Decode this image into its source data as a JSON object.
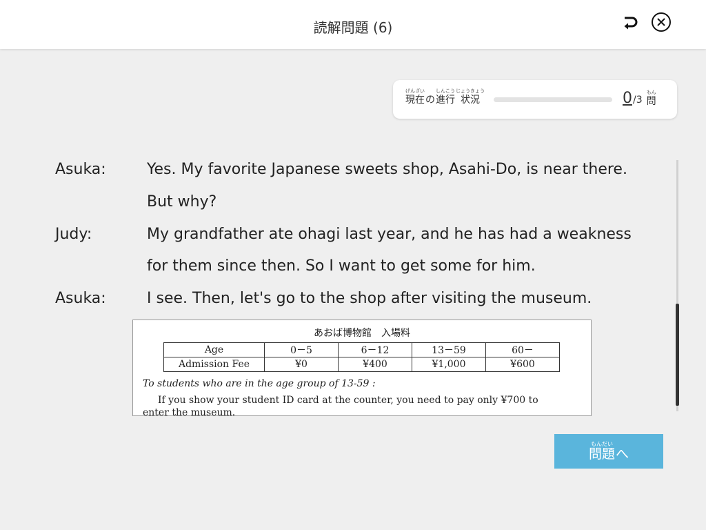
{
  "header": {
    "title": "読解問題 (6)"
  },
  "progress": {
    "label_parts": [
      {
        "base": "現在",
        "ruby": "げんざい"
      },
      {
        "base": "の",
        "ruby": ""
      },
      {
        "base": "進行",
        "ruby": "しんこう"
      },
      {
        "base": "状況",
        "ruby": "じょうきょう"
      }
    ],
    "current": "0",
    "total": "/3",
    "unit_base": "問",
    "unit_ruby": "もん",
    "fraction": 0
  },
  "dialogue": [
    {
      "speaker": "Asuka:",
      "lines": [
        "Yes. My favorite Japanese sweets shop, Asahi-Do, is near there.",
        "But why?"
      ]
    },
    {
      "speaker": "Judy:",
      "lines": [
        "My grandfather ate ohagi last year, and he has had a weakness",
        "for them since then. So I want to get some for him."
      ]
    },
    {
      "speaker": "Asuka:",
      "lines": [
        "I see. Then, let's go to the shop after visiting the museum."
      ]
    }
  ],
  "document": {
    "title": "あおば博物館　入場料",
    "table": {
      "rows": [
        [
          "Age",
          "0－5",
          "6－12",
          "13－59",
          "60－"
        ],
        [
          "Admission Fee",
          "¥0",
          "¥400",
          "¥1,000",
          "¥600"
        ]
      ]
    },
    "note": "To students who are in the age group of 13-59 :",
    "text_line1": "If you show your student ID card at the counter, you need to pay only ¥700 to",
    "text_line2": "enter the museum."
  },
  "next_button": {
    "base": "問題",
    "ruby": "もんだい",
    "suffix": "へ"
  },
  "colors": {
    "accent": "#5ab5dc",
    "background": "#efefef"
  }
}
